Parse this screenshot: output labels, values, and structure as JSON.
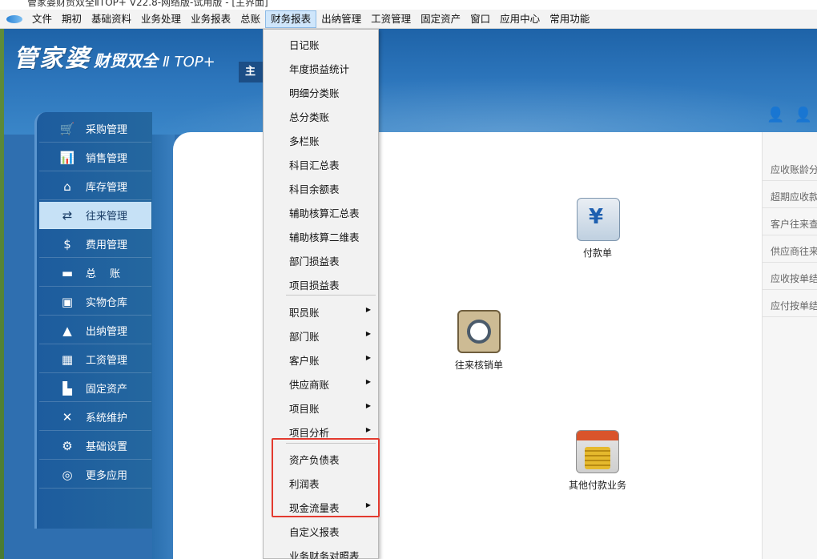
{
  "window": {
    "title": "管家婆财贸双全ⅡTOP+ V22.8-网络版-试用版 - [主界面]"
  },
  "menubar": {
    "items": [
      "文件",
      "期初",
      "基础资料",
      "业务处理",
      "业务报表",
      "总账",
      "财务报表",
      "出纳管理",
      "工资管理",
      "固定资产",
      "窗口",
      "应用中心",
      "常用功能"
    ]
  },
  "brand": {
    "name": "管家婆",
    "sub": "财贸双全",
    "version": "Ⅱ TOP+"
  },
  "main_tab": {
    "label": "主界"
  },
  "sidebar": {
    "items": [
      {
        "label": "采购管理",
        "icon": "cart-icon"
      },
      {
        "label": "销售管理",
        "icon": "bar-chart-icon"
      },
      {
        "label": "库存管理",
        "icon": "house-icon"
      },
      {
        "label": "往来管理",
        "icon": "exchange-icon"
      },
      {
        "label": "费用管理",
        "icon": "dollar-icon"
      },
      {
        "label": "总　 账",
        "icon": "ledger-icon"
      },
      {
        "label": "实物仓库",
        "icon": "warehouse-icon"
      },
      {
        "label": "出纳管理",
        "icon": "money-bag-icon"
      },
      {
        "label": "工资管理",
        "icon": "grid-icon"
      },
      {
        "label": "固定资产",
        "icon": "boxes-icon"
      },
      {
        "label": "系统维护",
        "icon": "tools-icon"
      },
      {
        "label": "基础设置",
        "icon": "gear-icon"
      },
      {
        "label": "更多应用",
        "icon": "target-icon"
      }
    ],
    "active_index": 3
  },
  "content": {
    "functions": [
      {
        "label": "付款单",
        "icon": "payment-slip-icon"
      },
      {
        "label": "往来核销单",
        "icon": "verification-icon"
      },
      {
        "label": "其他付款业务",
        "icon": "coins-icon"
      }
    ]
  },
  "right_panel": {
    "items": [
      "应收账龄分",
      "超期应收款",
      "客户往来查",
      "供应商往来",
      "应收按单结",
      "应付按单结"
    ]
  },
  "dropdown": {
    "items": [
      {
        "label": "日记账",
        "submenu": false
      },
      {
        "label": "年度损益统计",
        "submenu": false
      },
      {
        "label": "明细分类账",
        "submenu": false
      },
      {
        "label": "总分类账",
        "submenu": false
      },
      {
        "label": "多栏账",
        "submenu": false
      },
      {
        "label": "科目汇总表",
        "submenu": false
      },
      {
        "label": "科目余额表",
        "submenu": false
      },
      {
        "label": "辅助核算汇总表",
        "submenu": false
      },
      {
        "label": "辅助核算二维表",
        "submenu": false
      },
      {
        "label": "部门损益表",
        "submenu": false
      },
      {
        "label": "项目损益表",
        "submenu": false
      },
      {
        "label": "职员账",
        "submenu": true
      },
      {
        "label": "部门账",
        "submenu": true
      },
      {
        "label": "客户账",
        "submenu": true
      },
      {
        "label": "供应商账",
        "submenu": true
      },
      {
        "label": "项目账",
        "submenu": true
      },
      {
        "label": "项目分析",
        "submenu": true
      },
      {
        "label": "资产负债表",
        "submenu": false
      },
      {
        "label": "利润表",
        "submenu": false
      },
      {
        "label": "现金流量表",
        "submenu": true
      },
      {
        "label": "自定义报表",
        "submenu": false
      },
      {
        "label": "业务财务对照表",
        "submenu": false
      }
    ],
    "submenu_arrow": "▶"
  },
  "colors": {
    "accent_blue": "#2f6fb0",
    "highlight_red": "#e33a2f",
    "active_item": "#c6e1f6"
  }
}
